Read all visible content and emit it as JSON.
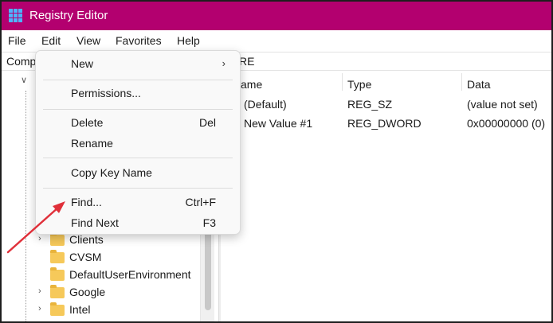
{
  "window": {
    "title": "Registry Editor"
  },
  "menubar": {
    "items": [
      {
        "label": "File"
      },
      {
        "label": "Edit"
      },
      {
        "label": "View"
      },
      {
        "label": "Favorites"
      },
      {
        "label": "Help"
      }
    ]
  },
  "address": {
    "left_text": "Comp",
    "right_text": "RE"
  },
  "tree": {
    "items": [
      {
        "label": "Clients"
      },
      {
        "label": "CVSM"
      },
      {
        "label": "DefaultUserEnvironment"
      },
      {
        "label": "Google"
      },
      {
        "label": "Intel"
      }
    ]
  },
  "values": {
    "headers": {
      "name": "ame",
      "type": "Type",
      "data": "Data"
    },
    "rows": [
      {
        "name": "(Default)",
        "type": "REG_SZ",
        "data": "(value not set)"
      },
      {
        "name": "New Value #1",
        "type": "REG_DWORD",
        "data": "0x00000000 (0)"
      }
    ]
  },
  "edit_menu": {
    "new": "New",
    "permissions": "Permissions...",
    "delete": "Delete",
    "delete_accel": "Del",
    "rename": "Rename",
    "copy_key_name": "Copy Key Name",
    "find": "Find...",
    "find_accel": "Ctrl+F",
    "find_next": "Find Next",
    "find_next_accel": "F3"
  },
  "colors": {
    "titlebar": "#b3006f",
    "annotation_arrow": "#e0303a",
    "folder": "#f6c95a"
  }
}
